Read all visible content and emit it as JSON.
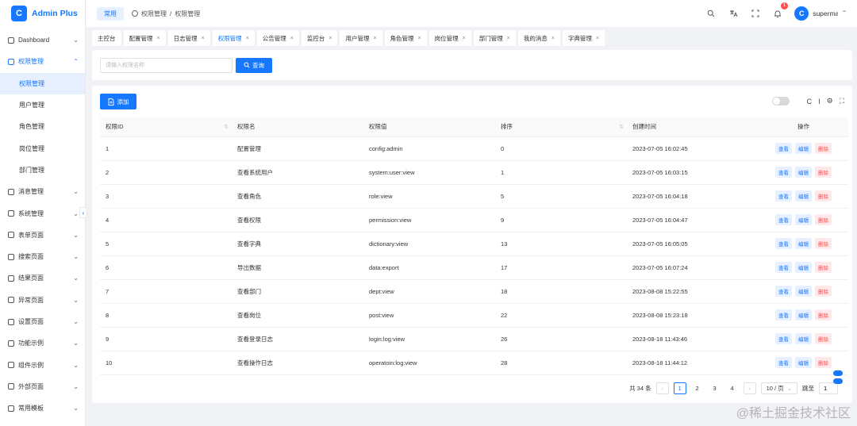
{
  "app": {
    "name": "Admin Plus",
    "logo_letter": "C"
  },
  "sidebar": {
    "items": [
      {
        "label": "Dashboard",
        "icon": "dashboard-icon",
        "chevron": "⌄",
        "state": ""
      },
      {
        "label": "权限管理",
        "icon": "shield-icon",
        "chevron": "⌃",
        "state": "open"
      },
      {
        "label": "权限管理",
        "icon": "",
        "chevron": "",
        "state": "sub active"
      },
      {
        "label": "用户管理",
        "icon": "",
        "chevron": "",
        "state": "sub"
      },
      {
        "label": "角色管理",
        "icon": "",
        "chevron": "",
        "state": "sub"
      },
      {
        "label": "岗位管理",
        "icon": "",
        "chevron": "",
        "state": "sub"
      },
      {
        "label": "部门管理",
        "icon": "",
        "chevron": "",
        "state": "sub"
      },
      {
        "label": "消息管理",
        "icon": "message-icon",
        "chevron": "⌄",
        "state": ""
      },
      {
        "label": "系统管理",
        "icon": "settings-icon",
        "chevron": "⌄",
        "state": ""
      },
      {
        "label": "表单页面",
        "icon": "form-icon",
        "chevron": "⌄",
        "state": ""
      },
      {
        "label": "搜索页面",
        "icon": "search-page-icon",
        "chevron": "⌄",
        "state": ""
      },
      {
        "label": "结果页面",
        "icon": "check-circle-icon",
        "chevron": "⌄",
        "state": ""
      },
      {
        "label": "异常页面",
        "icon": "warning-icon",
        "chevron": "⌄",
        "state": ""
      },
      {
        "label": "设置页面",
        "icon": "gear-icon",
        "chevron": "⌄",
        "state": ""
      },
      {
        "label": "功能示例",
        "icon": "grid-icon",
        "chevron": "⌄",
        "state": ""
      },
      {
        "label": "组件示例",
        "icon": "component-icon",
        "chevron": "⌄",
        "state": ""
      },
      {
        "label": "外部页面",
        "icon": "monitor-icon",
        "chevron": "⌄",
        "state": ""
      },
      {
        "label": "常用模板",
        "icon": "template-icon",
        "chevron": "⌄",
        "state": ""
      }
    ],
    "collapse_glyph": "‹"
  },
  "header": {
    "home_pill": "常用",
    "breadcrumb": [
      "权限管理",
      "/",
      "权限管理"
    ],
    "notification_count": "1",
    "user_name": "superman",
    "avatar_letter": "C"
  },
  "tabs": [
    {
      "label": "主控台",
      "closable": false,
      "active": false
    },
    {
      "label": "配置管理",
      "closable": true,
      "active": false
    },
    {
      "label": "日志管理",
      "closable": true,
      "active": false
    },
    {
      "label": "权限管理",
      "closable": true,
      "active": true
    },
    {
      "label": "公告管理",
      "closable": true,
      "active": false
    },
    {
      "label": "监控台",
      "closable": true,
      "active": false
    },
    {
      "label": "用户管理",
      "closable": true,
      "active": false
    },
    {
      "label": "角色管理",
      "closable": true,
      "active": false
    },
    {
      "label": "岗位管理",
      "closable": true,
      "active": false
    },
    {
      "label": "部门管理",
      "closable": true,
      "active": false
    },
    {
      "label": "我的消息",
      "closable": true,
      "active": false
    },
    {
      "label": "字典管理",
      "closable": true,
      "active": false
    }
  ],
  "search": {
    "placeholder": "请输入权限名称",
    "button_label": "查询"
  },
  "toolbar": {
    "add_label": "添加"
  },
  "table": {
    "columns": [
      "权限ID",
      "权限名",
      "权限值",
      "排序",
      "创建时间",
      "操作"
    ],
    "actions": {
      "view": "查看",
      "edit": "编辑",
      "delete": "删除"
    },
    "rows": [
      {
        "id": "1",
        "name": "配置管理",
        "value": "config:admin",
        "sort": "0",
        "created": "2023-07-05 16:02:45"
      },
      {
        "id": "2",
        "name": "查看系统用户",
        "value": "system:user:view",
        "sort": "1",
        "created": "2023-07-05 16:03:15"
      },
      {
        "id": "3",
        "name": "查看角色",
        "value": "role:view",
        "sort": "5",
        "created": "2023-07-05 16:04:18"
      },
      {
        "id": "4",
        "name": "查看权限",
        "value": "permission:view",
        "sort": "9",
        "created": "2023-07-05 16:04:47"
      },
      {
        "id": "5",
        "name": "查看字典",
        "value": "dictionary:view",
        "sort": "13",
        "created": "2023-07-05 16:05:05"
      },
      {
        "id": "6",
        "name": "导出数据",
        "value": "data:export",
        "sort": "17",
        "created": "2023-07-05 16:07:24"
      },
      {
        "id": "7",
        "name": "查看部门",
        "value": "dept:view",
        "sort": "18",
        "created": "2023-08-08 15:22:55"
      },
      {
        "id": "8",
        "name": "查看岗位",
        "value": "post:view",
        "sort": "22",
        "created": "2023-08-08 15:23:18"
      },
      {
        "id": "9",
        "name": "查看登录日志",
        "value": "login:log:view",
        "sort": "26",
        "created": "2023-08-18 11:43:46"
      },
      {
        "id": "10",
        "name": "查看操作日志",
        "value": "operatoin:log:view",
        "sort": "28",
        "created": "2023-08-18 11:44:12"
      }
    ]
  },
  "pagination": {
    "total_label": "共 34 条",
    "pages": [
      "1",
      "2",
      "3",
      "4"
    ],
    "current": "1",
    "page_size": "10 / 页",
    "jump_label": "跳至",
    "jump_value": "1",
    "prev": "‹",
    "next": "›"
  },
  "watermark": "@稀土掘金技术社区",
  "colors": {
    "primary": "#1677ff",
    "danger": "#ff4d4f",
    "background": "#f0f2f5"
  }
}
